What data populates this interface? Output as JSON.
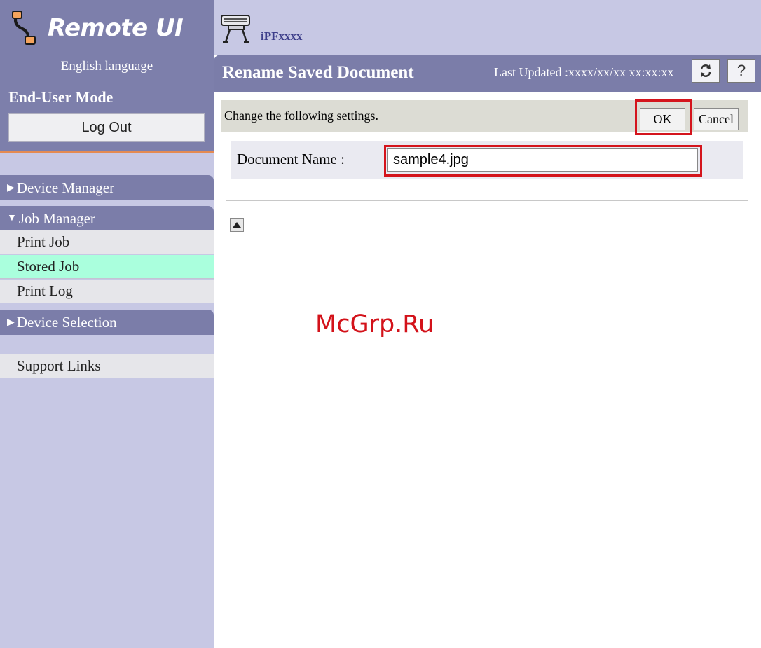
{
  "sidebar": {
    "app_name": "Remote UI",
    "language": "English language",
    "mode": "End-User Mode",
    "logout_label": "Log Out",
    "device_manager": "Device Manager",
    "job_manager": "Job Manager",
    "job_items": [
      "Print Job",
      "Stored Job",
      "Print Log"
    ],
    "device_selection": "Device Selection",
    "support_links": "Support Links"
  },
  "header": {
    "device_name": "iPFxxxx",
    "title": "Rename Saved Document",
    "last_updated": "Last Updated :xxxx/xx/xx xx:xx:xx",
    "help_label": "?"
  },
  "form": {
    "instruction": "Change the following settings.",
    "ok_label": "OK",
    "cancel_label": "Cancel",
    "document_name_label": "Document Name :",
    "document_name_value": "sample4.jpg"
  },
  "watermark": "McGrp.Ru",
  "colors": {
    "sidebar_bg": "#c7c8e4",
    "header_bar": "#7b7da9",
    "active_item": "#aaffdd",
    "highlight": "#d4141c",
    "accent_orange": "#e48a52"
  }
}
